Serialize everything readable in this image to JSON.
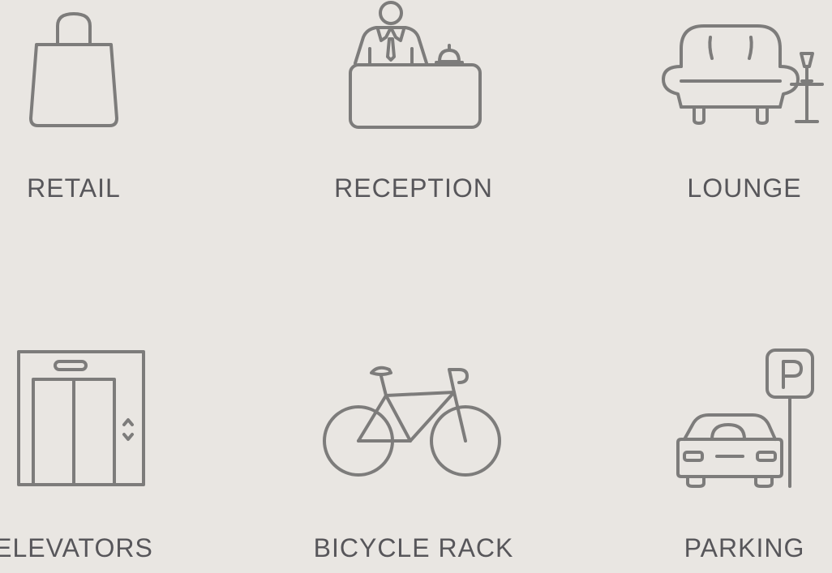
{
  "colors": {
    "background": "#e9e6e2",
    "icon_stroke": "#7d7c7b",
    "label_text": "#57565a"
  },
  "amenities": [
    {
      "label": "RETAIL",
      "icon": "shopping-bag-icon"
    },
    {
      "label": "RECEPTION",
      "icon": "reception-desk-icon"
    },
    {
      "label": "LOUNGE",
      "icon": "lounge-sofa-icon"
    },
    {
      "label": "ELEVATORS",
      "icon": "elevator-icon"
    },
    {
      "label": "BICYCLE RACK",
      "icon": "bicycle-icon"
    },
    {
      "label": "PARKING",
      "icon": "parking-car-icon"
    }
  ]
}
